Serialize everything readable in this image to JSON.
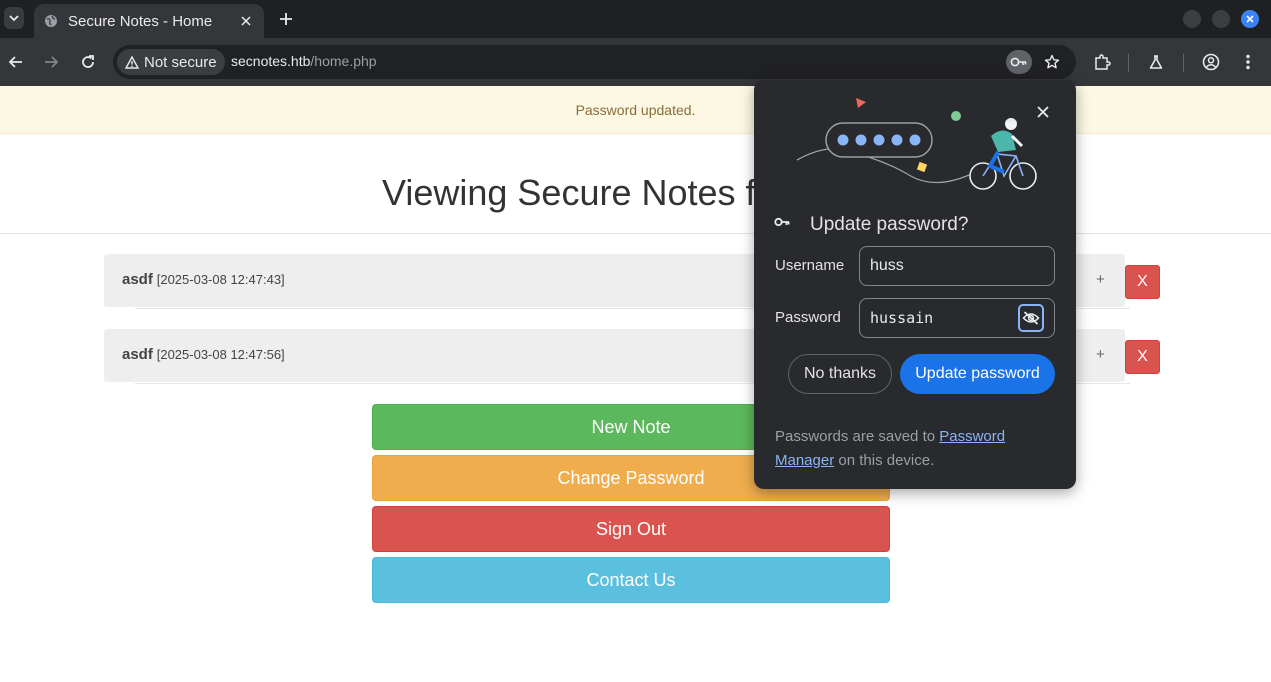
{
  "browser": {
    "tab": {
      "title": "Secure Notes - Home"
    },
    "security_chip": "Not secure",
    "url": {
      "host": "secnotes.htb",
      "path": "/home.php"
    }
  },
  "page": {
    "alert": "Password updated.",
    "title": "Viewing Secure Notes f",
    "notes": [
      {
        "name": "asdf",
        "date": "[2025-03-08 12:47:43]",
        "expand": "+",
        "delete": "X"
      },
      {
        "name": "asdf",
        "date": "[2025-03-08 12:47:56]",
        "expand": "+",
        "delete": "X"
      }
    ],
    "buttons": {
      "new_note": "New Note",
      "change_password": "Change Password",
      "sign_out": "Sign Out",
      "contact_us": "Contact Us"
    }
  },
  "password_bubble": {
    "title": "Update password?",
    "username_label": "Username",
    "username_value": "huss",
    "password_label": "Password",
    "password_value": "hussain",
    "no_thanks": "No thanks",
    "update": "Update password",
    "footer_prefix": "Passwords are saved to ",
    "footer_link": "Password Manager",
    "footer_suffix": " on this device."
  },
  "colors": {
    "accent_blue": "#1a73e8",
    "success": "#5cb85c",
    "warning": "#f0ad4e",
    "danger": "#d9534f",
    "info": "#5bc0de"
  },
  "icons": [
    "tab-search-icon",
    "globe-icon",
    "close-icon",
    "plus-icon",
    "back-icon",
    "forward-icon",
    "reload-icon",
    "warning-icon",
    "key-icon",
    "star-icon",
    "extensions-icon",
    "labs-icon",
    "profile-icon",
    "menu-icon",
    "eye-off-icon"
  ]
}
